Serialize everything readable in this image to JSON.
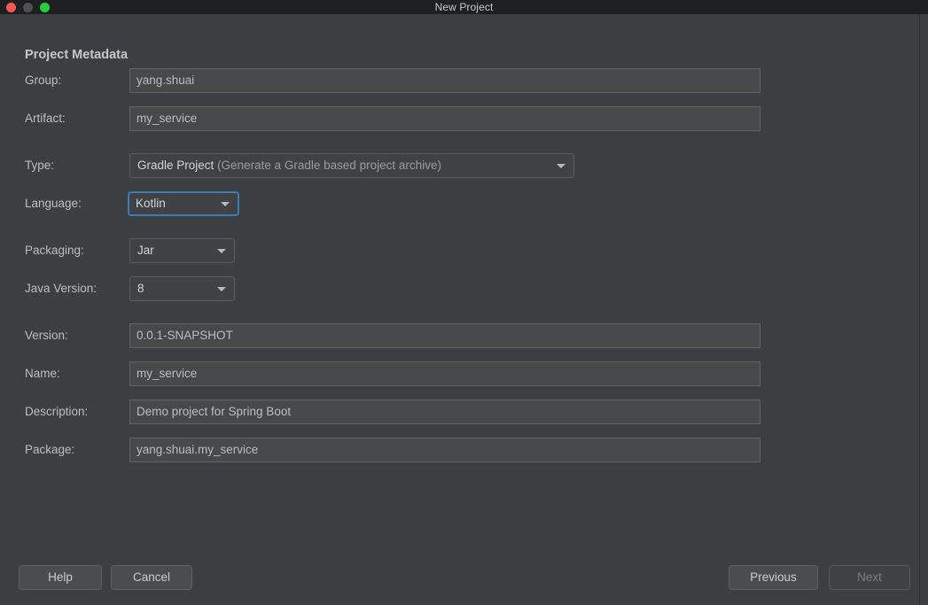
{
  "window": {
    "title": "New Project",
    "traffic_lights": [
      {
        "name": "close",
        "color": "#f9564f"
      },
      {
        "name": "minimize",
        "color": "#4e5052"
      },
      {
        "name": "zoom",
        "color": "#23d03a"
      }
    ],
    "background": "#3c3f41",
    "titlebar_background": "#1d1f21"
  },
  "heading": "Project Metadata",
  "fields": {
    "group": {
      "label": "Group:",
      "value": "yang.shuai"
    },
    "artifact": {
      "label": "Artifact:",
      "value": "my_service"
    },
    "type": {
      "label": "Type:",
      "value": "Gradle Project",
      "hint": "(Generate a Gradle based project archive)"
    },
    "language": {
      "label": "Language:",
      "value": "Kotlin",
      "focus_color": "#3d7bb5"
    },
    "packaging": {
      "label": "Packaging:",
      "value": "Jar"
    },
    "java_version": {
      "label": "Java Version:",
      "value": "8"
    },
    "version": {
      "label": "Version:",
      "value": "0.0.1-SNAPSHOT"
    },
    "name": {
      "label": "Name:",
      "value": "my_service"
    },
    "description": {
      "label": "Description:",
      "value": "Demo project for Spring Boot"
    },
    "package": {
      "label": "Package:",
      "value": "yang.shuai.my_service"
    }
  },
  "buttons": {
    "help": "Help",
    "cancel": "Cancel",
    "previous": "Previous",
    "next": "Next"
  }
}
